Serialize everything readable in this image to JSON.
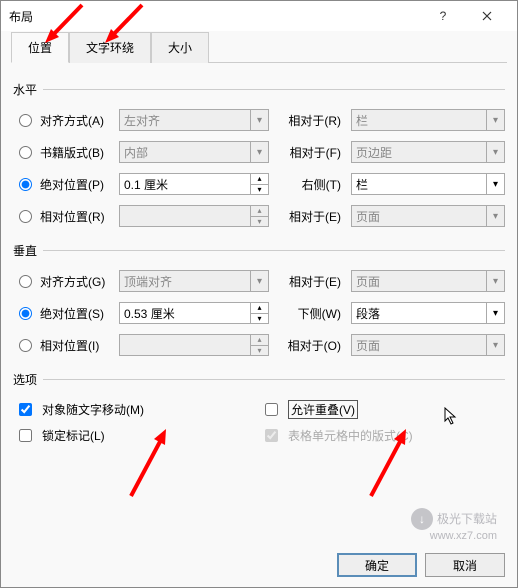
{
  "title": "布局",
  "tabs": {
    "position": "位置",
    "wrap": "文字环绕",
    "size": "大小"
  },
  "section": {
    "horizontal": "水平",
    "vertical": "垂直",
    "options": "选项"
  },
  "h": {
    "align_label": "对齐方式(A)",
    "align_val": "左对齐",
    "align_rel": "相对于(R)",
    "align_rel_val": "栏",
    "book_label": "书籍版式(B)",
    "book_val": "内部",
    "book_rel": "相对于(F)",
    "book_rel_val": "页边距",
    "abs_label": "绝对位置(P)",
    "abs_val": "0.1 厘米",
    "abs_rel": "右侧(T)",
    "abs_rel_val": "栏",
    "rel_label": "相对位置(R)",
    "rel_val": "",
    "rel_rel": "相对于(E)",
    "rel_rel_val": "页面"
  },
  "v": {
    "align_label": "对齐方式(G)",
    "align_val": "顶端对齐",
    "align_rel": "相对于(E)",
    "align_rel_val": "页面",
    "abs_label": "绝对位置(S)",
    "abs_val": "0.53 厘米",
    "abs_rel": "下侧(W)",
    "abs_rel_val": "段落",
    "rel_label": "相对位置(I)",
    "rel_val": "",
    "rel_rel": "相对于(O)",
    "rel_rel_val": "页面"
  },
  "opts": {
    "move": "对象随文字移动(M)",
    "lock": "锁定标记(L)",
    "overlap": "允许重叠(V)",
    "table": "表格单元格中的版式(C)"
  },
  "buttons": {
    "ok": "确定",
    "cancel": "取消"
  },
  "watermark": {
    "brand": "极光下载站",
    "url": "www.xz7.com"
  }
}
